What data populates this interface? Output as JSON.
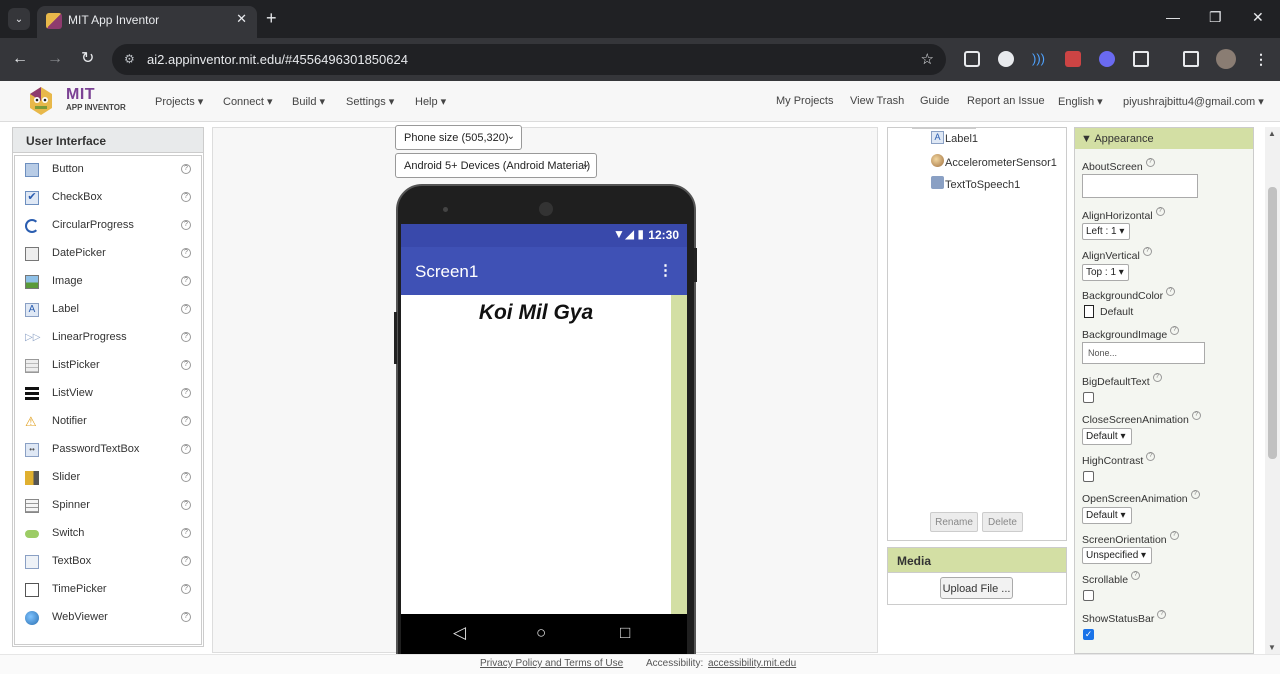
{
  "browser": {
    "tab_title": "MIT App Inventor",
    "url": "ai2.appinventor.mit.edu/#4556496301850624"
  },
  "app_header": {
    "logo_text": "MIT",
    "logo_subtext": "APP INVENTOR",
    "left_menus": [
      "Projects",
      "Connect",
      "Build",
      "Settings",
      "Help"
    ],
    "right_links": [
      "My Projects",
      "View Trash",
      "Guide",
      "Report an Issue"
    ],
    "language": "English",
    "account": "piyushrajbittu4@gmail.com"
  },
  "palette": {
    "header": "User Interface",
    "items": [
      {
        "label": "Button",
        "icon": "button-icon"
      },
      {
        "label": "CheckBox",
        "icon": "checkbox-icon"
      },
      {
        "label": "CircularProgress",
        "icon": "circular-progress-icon"
      },
      {
        "label": "DatePicker",
        "icon": "datepicker-icon"
      },
      {
        "label": "Image",
        "icon": "image-icon"
      },
      {
        "label": "Label",
        "icon": "label-icon"
      },
      {
        "label": "LinearProgress",
        "icon": "linear-progress-icon"
      },
      {
        "label": "ListPicker",
        "icon": "listpicker-icon"
      },
      {
        "label": "ListView",
        "icon": "listview-icon"
      },
      {
        "label": "Notifier",
        "icon": "notifier-icon"
      },
      {
        "label": "PasswordTextBox",
        "icon": "password-textbox-icon"
      },
      {
        "label": "Slider",
        "icon": "slider-icon"
      },
      {
        "label": "Spinner",
        "icon": "spinner-icon"
      },
      {
        "label": "Switch",
        "icon": "switch-icon"
      },
      {
        "label": "TextBox",
        "icon": "textbox-icon"
      },
      {
        "label": "TimePicker",
        "icon": "timepicker-icon"
      },
      {
        "label": "WebViewer",
        "icon": "webviewer-icon"
      }
    ]
  },
  "viewer": {
    "phone_size": "Phone size (505,320)",
    "theme": "Android 5+ Devices (Android Material)",
    "status_time": "12:30",
    "screen_title": "Screen1",
    "label_text": "Koi Mil Gya",
    "accent_color": "#3f51b5",
    "status_color": "#3949ab"
  },
  "components": {
    "items": [
      "Label1",
      "AccelerometerSensor1",
      "TextToSpeech1"
    ],
    "rename_label": "Rename",
    "delete_label": "Delete",
    "media_header": "Media",
    "upload_label": "Upload File ..."
  },
  "properties": {
    "section": "Appearance",
    "about_screen_label": "AboutScreen",
    "align_h_label": "AlignHorizontal",
    "align_h_value": "Left : 1",
    "align_v_label": "AlignVertical",
    "align_v_value": "Top : 1",
    "bg_color_label": "BackgroundColor",
    "bg_color_value": "Default",
    "bg_image_label": "BackgroundImage",
    "bg_image_value": "None...",
    "big_default_text_label": "BigDefaultText",
    "close_anim_label": "CloseScreenAnimation",
    "close_anim_value": "Default",
    "high_contrast_label": "HighContrast",
    "open_anim_label": "OpenScreenAnimation",
    "open_anim_value": "Default",
    "orientation_label": "ScreenOrientation",
    "orientation_value": "Unspecified",
    "scrollable_label": "Scrollable",
    "show_status_label": "ShowStatusBar"
  },
  "footer": {
    "privacy": "Privacy Policy and Terms of Use",
    "accessibility_prefix": "Accessibility:",
    "accessibility_link": "accessibility.mit.edu"
  }
}
